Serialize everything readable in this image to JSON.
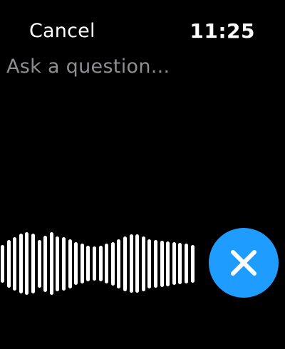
{
  "header": {
    "cancel_label": "Cancel",
    "time": "11:25"
  },
  "prompt": {
    "placeholder": "Ask a question..."
  },
  "waveform": {
    "levels": [
      0.55,
      0.7,
      0.78,
      0.88,
      0.92,
      0.88,
      0.7,
      0.82,
      0.92,
      0.8,
      0.78,
      0.72,
      0.62,
      0.58,
      0.52,
      0.5,
      0.52,
      0.58,
      0.64,
      0.72,
      0.8,
      0.85,
      0.85,
      0.8,
      0.72,
      0.7,
      0.68,
      0.66,
      0.62,
      0.6,
      0.58,
      0.55
    ]
  },
  "controls": {
    "close_icon": "close-icon",
    "accent_color": "#1e9cff"
  }
}
